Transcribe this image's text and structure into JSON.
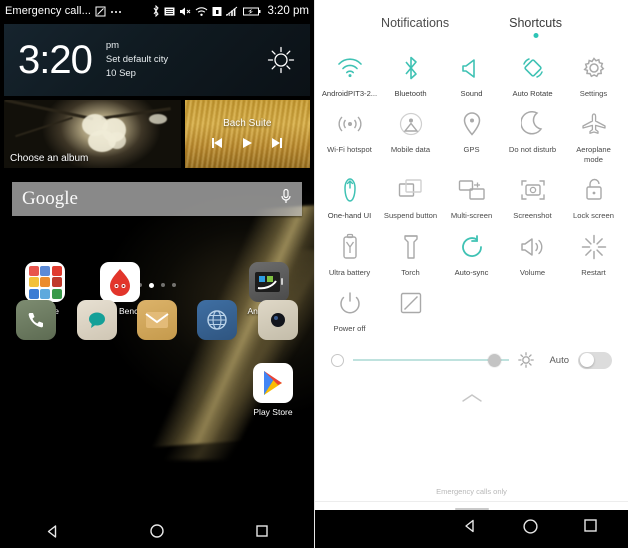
{
  "colors": {
    "accent_teal": "#2ec4b6",
    "inactive_gray": "#9b9b9b",
    "label_gray": "#4a4a4a"
  },
  "left_phone": {
    "statusbar": {
      "title": "Emergency call...",
      "icons": [
        "app-icon",
        "more-dots-icon",
        "bluetooth-icon",
        "alarm-icon",
        "volume-mute-icon",
        "wifi-icon",
        "lock-icon",
        "signal-icon",
        "battery-icon"
      ],
      "time": "3:20 pm"
    },
    "clock_widget": {
      "time": "3:20",
      "meridiem": "pm",
      "city": "Set default city",
      "date": "10 Sep",
      "weather_icon": "sun-icon"
    },
    "album_widget": {
      "label": "Choose an album"
    },
    "music_widget": {
      "title": "Bach Suite",
      "controls": [
        "previous-icon",
        "play-icon",
        "next-icon"
      ]
    },
    "search_widget": {
      "brand": "Google",
      "mic_icon": "microphone-icon"
    },
    "apps": [
      {
        "label": "Google",
        "icon": "google-folder-icon"
      },
      {
        "label": "AnTuTu Benchm.",
        "icon": "antutu-icon"
      },
      {
        "label": "",
        "icon": "empty-slot"
      },
      {
        "label": "AndroidPIT",
        "icon": "androidpit-icon"
      },
      {
        "label": "Play Store",
        "icon": "play-store-icon"
      }
    ],
    "page_dots": {
      "count": 4,
      "active_index": 1
    },
    "dock": [
      {
        "name": "phone",
        "icon": "phone-icon"
      },
      {
        "name": "messages",
        "icon": "chat-bubble-icon"
      },
      {
        "name": "email",
        "icon": "envelope-icon"
      },
      {
        "name": "browser",
        "icon": "globe-icon"
      },
      {
        "name": "camera",
        "icon": "camera-icon"
      }
    ],
    "navbar": [
      {
        "name": "back",
        "icon": "back-triangle-icon"
      },
      {
        "name": "home",
        "icon": "home-circle-icon"
      },
      {
        "name": "recents",
        "icon": "recents-square-icon"
      }
    ]
  },
  "right_panel": {
    "tabs": [
      {
        "label": "Notifications",
        "active": false
      },
      {
        "label": "Shortcuts",
        "active": true
      }
    ],
    "shortcuts": [
      {
        "label": "AndroidPIT3-2...",
        "icon": "wifi-icon",
        "active": true
      },
      {
        "label": "Bluetooth",
        "icon": "bluetooth-icon",
        "active": true
      },
      {
        "label": "Sound",
        "icon": "sound-icon",
        "active": true
      },
      {
        "label": "Auto Rotate",
        "icon": "auto-rotate-icon",
        "active": true
      },
      {
        "label": "Settings",
        "icon": "gear-icon",
        "active": false
      },
      {
        "label": "Wi-Fi hotspot",
        "icon": "hotspot-icon",
        "active": false
      },
      {
        "label": "Mobile data",
        "icon": "mobile-data-icon",
        "active": false
      },
      {
        "label": "GPS",
        "icon": "gps-pin-icon",
        "active": false
      },
      {
        "label": "Do not disturb",
        "icon": "moon-icon",
        "active": false
      },
      {
        "label": "Aeroplane\nmode",
        "icon": "aeroplane-icon",
        "active": false
      },
      {
        "label": "One-hand UI",
        "icon": "one-hand-icon",
        "active": true
      },
      {
        "label": "Suspend button",
        "icon": "suspend-button-icon",
        "active": false
      },
      {
        "label": "Multi-screen",
        "icon": "multi-screen-icon",
        "active": false
      },
      {
        "label": "Screenshot",
        "icon": "screenshot-icon",
        "active": false
      },
      {
        "label": "Lock screen",
        "icon": "lock-open-icon",
        "active": false
      },
      {
        "label": "Ultra battery",
        "icon": "ultra-battery-icon",
        "active": false
      },
      {
        "label": "Torch",
        "icon": "torch-icon",
        "active": false
      },
      {
        "label": "Auto-sync",
        "icon": "auto-sync-icon",
        "active": true
      },
      {
        "label": "Volume",
        "icon": "volume-icon",
        "active": false
      },
      {
        "label": "Restart",
        "icon": "restart-icon",
        "active": false
      },
      {
        "label": "Power off",
        "icon": "power-off-icon",
        "active": false
      },
      {
        "label": "",
        "icon": "edit-icon",
        "active": false
      }
    ],
    "brightness": {
      "min_icon": "brightness-low-icon",
      "max_icon": "brightness-high-icon",
      "value_percent": 86,
      "auto_label": "Auto",
      "auto_on": false
    },
    "collapse_icon": "chevron-up-icon",
    "carrier_status": "Emergency calls only",
    "navbar": [
      {
        "name": "back",
        "icon": "back-triangle-icon"
      },
      {
        "name": "home",
        "icon": "home-circle-icon"
      },
      {
        "name": "recents",
        "icon": "recents-square-icon"
      }
    ]
  }
}
